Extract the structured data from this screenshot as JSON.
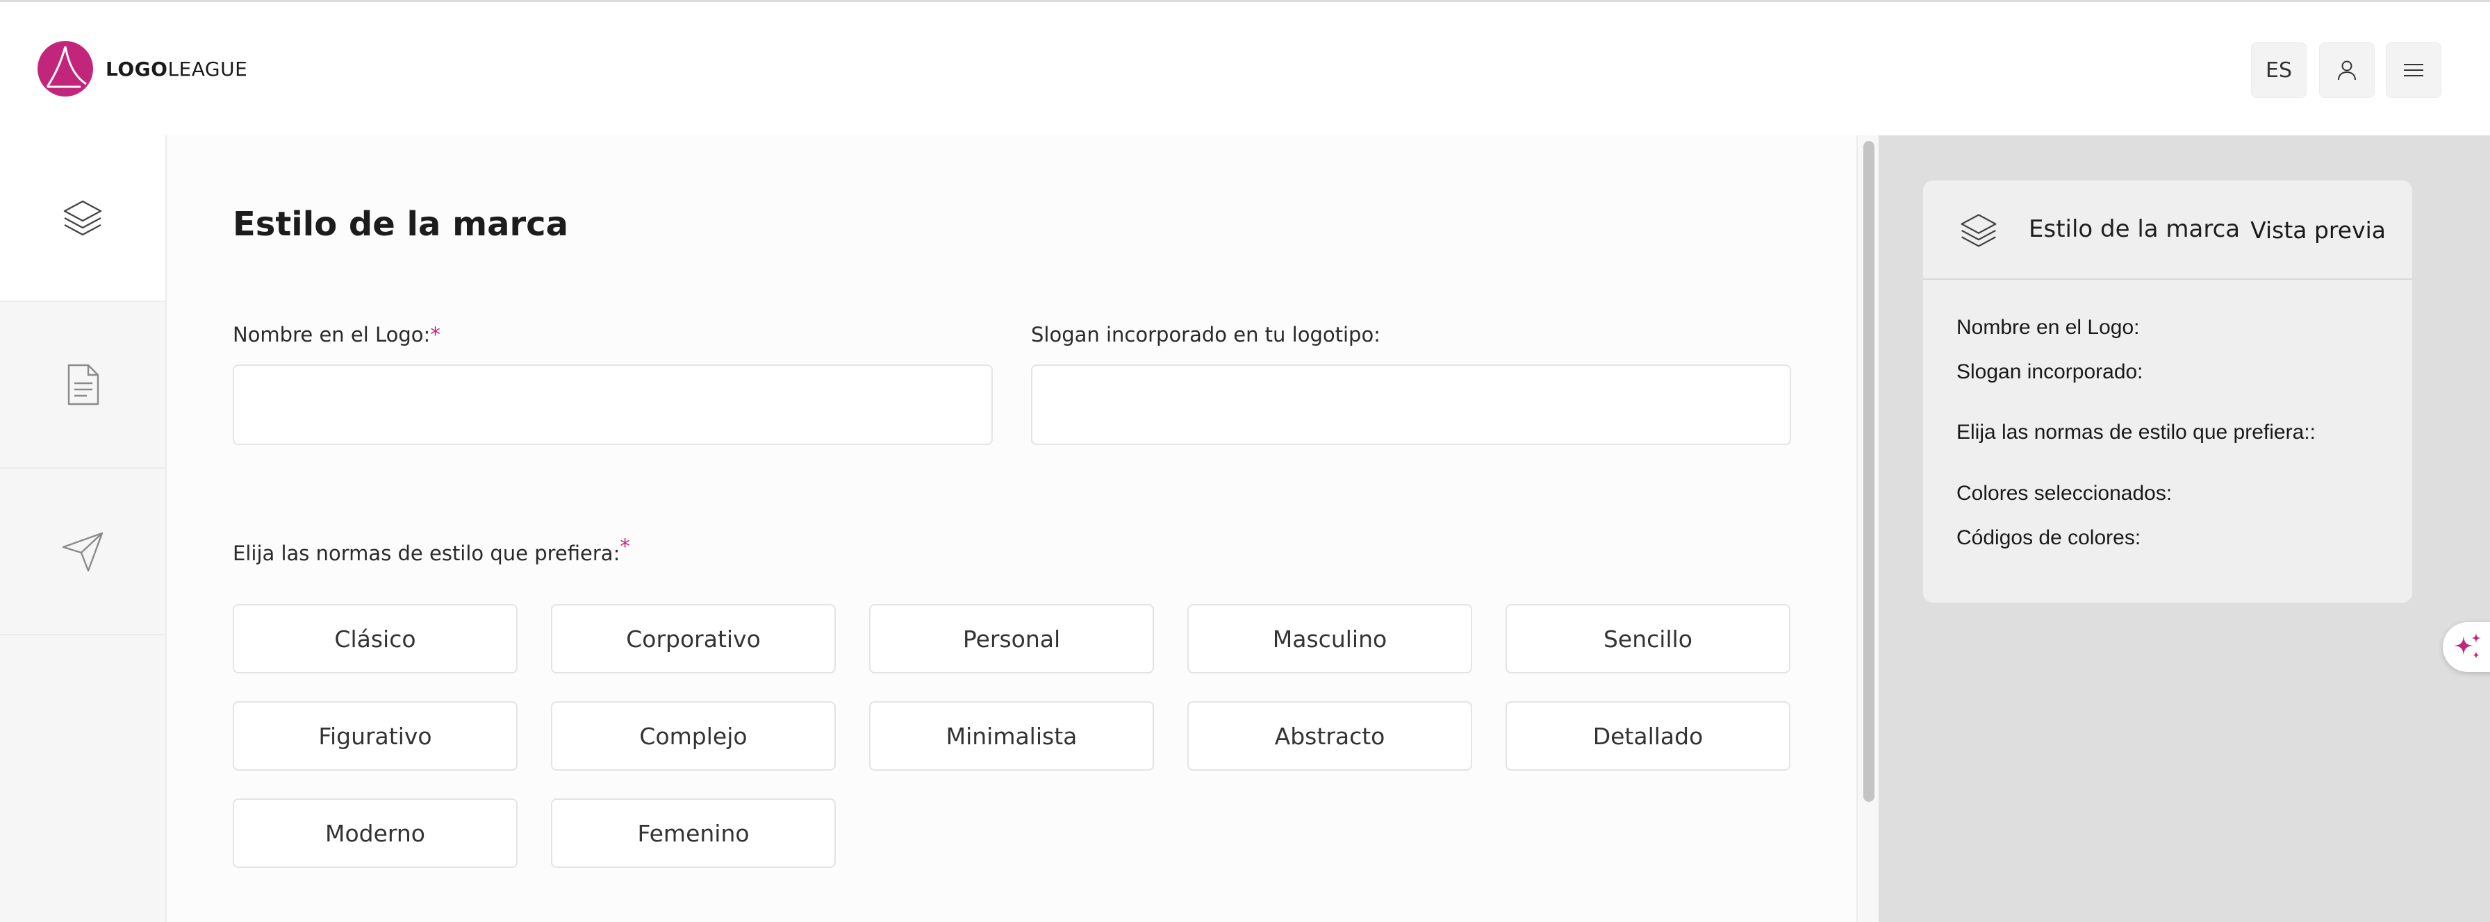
{
  "header": {
    "logo_bold": "LOGO",
    "logo_light": "LEAGUE",
    "lang_label": "ES",
    "user_icon": "user-icon",
    "menu_icon": "hamburger-menu-icon"
  },
  "rail": {
    "items": [
      {
        "icon": "layers-icon"
      },
      {
        "icon": "document-icon"
      },
      {
        "icon": "send-icon"
      }
    ]
  },
  "form": {
    "title": "Estilo de la marca",
    "name_label": "Nombre en el Logo:",
    "name_value": "",
    "slogan_label": "Slogan incorporado en tu logotipo:",
    "slogan_value": "",
    "styles_label": "Elija las normas de estilo que prefiera:",
    "required_mark": "*",
    "styles": [
      "Clásico",
      "Corporativo",
      "Personal",
      "Masculino",
      "Sencillo",
      "Figurativo",
      "Complejo",
      "Minimalista",
      "Abstracto",
      "Detallado",
      "Moderno",
      "Femenino"
    ]
  },
  "preview": {
    "title": "Estilo de la marca",
    "link": "Vista previa",
    "name_line": "Nombre en el Logo:",
    "slogan_line": "Slogan incorporado:",
    "styles_line": "Elija las normas de estilo que prefiera::",
    "colors_line": "Colores seleccionados:",
    "codes_line": "Códigos de colores:"
  },
  "colors": {
    "brand": "#c2267a",
    "preview_bg": "#dedede"
  }
}
